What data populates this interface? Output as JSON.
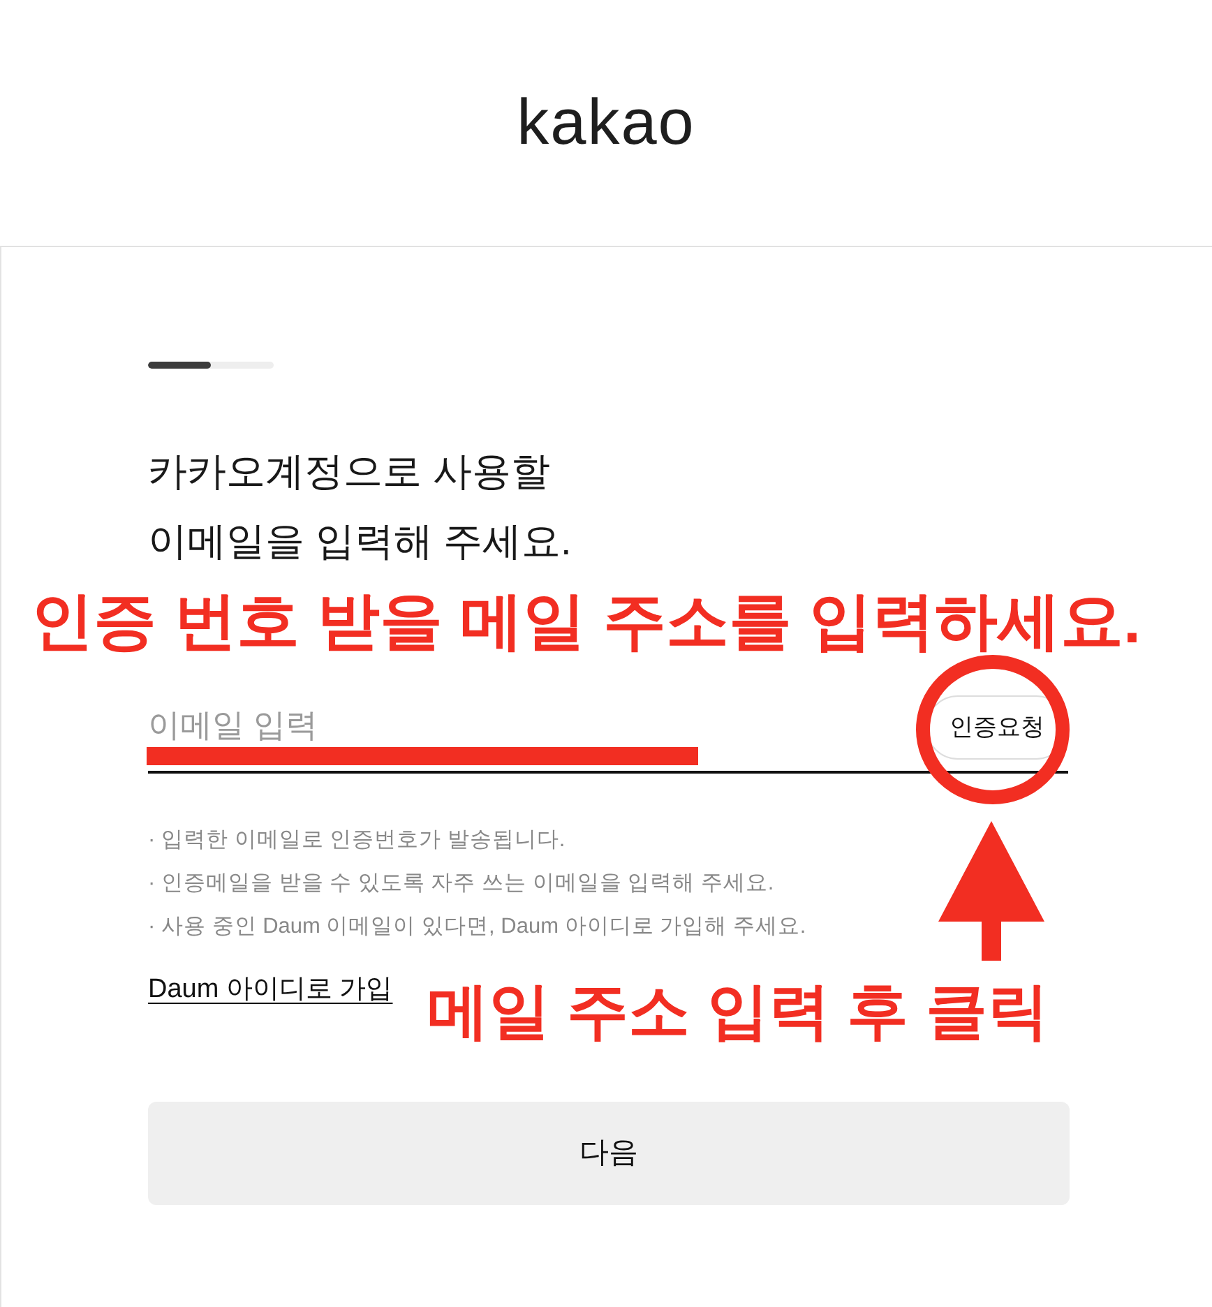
{
  "header": {
    "logo": "kakao"
  },
  "progress": {
    "level": 0.5
  },
  "title": "카카오계정으로 사용할\n이메일을 입력해 주세요.",
  "email_field": {
    "placeholder": "이메일 입력",
    "button": "인증요청"
  },
  "notes": [
    "· 입력한 이메일로 인증번호가 발송됩니다.",
    "· 인증메일을 받을 수 있도록 자주 쓰는 이메일을 입력해 주세요.",
    "· 사용 중인 Daum 이메일이 있다면, Daum 아이디로 가입해 주세요."
  ],
  "daum_link": "Daum 아이디로 가입",
  "next_button": "다음",
  "annotations": {
    "instruction": "인증 번호 받을 메일 주소를 입력하세요.",
    "caption": "메일 주소 입력 후 클릭"
  }
}
